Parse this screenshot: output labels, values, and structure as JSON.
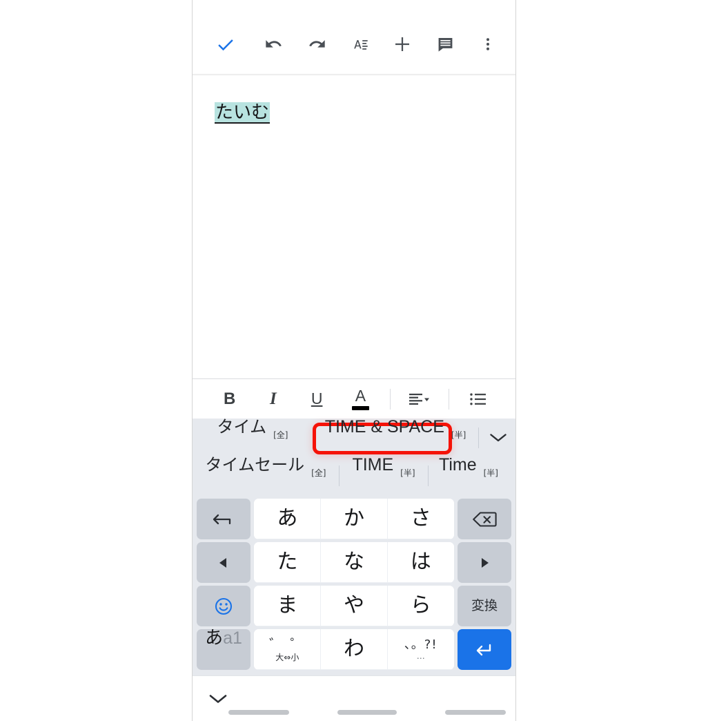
{
  "app": {
    "name": "Google Docs mobile editor with Gboard Japanese 12-key keyboard"
  },
  "top_toolbar": {
    "buttons": [
      {
        "name": "accept-check",
        "icon": "check-icon",
        "label": "完了",
        "color": "#1a73e8"
      },
      {
        "name": "undo",
        "icon": "undo-icon",
        "label": "元に戻す",
        "color": "#4a4f55"
      },
      {
        "name": "redo",
        "icon": "redo-icon",
        "label": "やり直し",
        "color": "#4a4f55"
      },
      {
        "name": "text-format",
        "icon": "text-format-icon",
        "label": "書式設定",
        "color": "#4a4f55"
      },
      {
        "name": "insert",
        "icon": "plus-icon",
        "label": "挿入",
        "color": "#4a4f55"
      },
      {
        "name": "comment",
        "icon": "comment-icon",
        "label": "コメント",
        "color": "#4a4f55"
      },
      {
        "name": "more",
        "icon": "more-vertical-icon",
        "label": "その他",
        "color": "#4a4f55"
      }
    ]
  },
  "document": {
    "composing_text": "たいむ",
    "highlight_color": "#b8e3e0",
    "text_color": "#17181a"
  },
  "format_toolbar": {
    "bold": "B",
    "italic": "I",
    "underline": "U",
    "text_color_glyph": "A",
    "text_color_swatch": "#000000",
    "align": "align-left",
    "list": "bulleted-list"
  },
  "suggestions": {
    "row1": [
      {
        "text": "タイム",
        "tag": "[全]"
      },
      {
        "text": "TIME & SPACE",
        "tag": "[半]",
        "highlighted": true
      }
    ],
    "expand_icon": "chevron-down-icon",
    "row2": [
      {
        "text": "タイムセール",
        "tag": "[全]"
      },
      {
        "text": "TIME",
        "tag": "[半]"
      },
      {
        "text": "Time",
        "tag": "[半]"
      }
    ],
    "annotation_color": "#f51207"
  },
  "keyboard": {
    "rows": [
      {
        "left": {
          "name": "undo-key",
          "icon": "undo-arrow-icon",
          "label": "元に戻す"
        },
        "chars": [
          "あ",
          "か",
          "さ"
        ],
        "right": {
          "name": "backspace-key",
          "icon": "backspace-icon",
          "label": "削除"
        }
      },
      {
        "left": {
          "name": "cursor-left-key",
          "icon": "triangle-left-icon",
          "label": "←"
        },
        "chars": [
          "た",
          "な",
          "は"
        ],
        "right": {
          "name": "cursor-right-key",
          "icon": "triangle-right-icon",
          "label": "→"
        }
      },
      {
        "left": {
          "name": "emoji-key",
          "icon": "smiley-icon",
          "label": "絵文字"
        },
        "chars": [
          "ま",
          "や",
          "ら"
        ],
        "right": {
          "name": "convert-key",
          "icon": "",
          "label": "変換"
        }
      },
      {
        "left": {
          "name": "input-mode-key",
          "icon": "",
          "label_on": "あ",
          "label_off": "a1"
        },
        "chars": [
          "dakuten",
          "わ",
          "punct"
        ],
        "right": {
          "name": "enter-key",
          "icon": "return-icon",
          "label": "改行"
        }
      }
    ],
    "dakuten_key": {
      "top": "゛ ゜",
      "bottom": "大⇔小"
    },
    "punct_key": {
      "main": "、。?!",
      "dots": "…"
    },
    "key_bg": "#ffffff",
    "func_bg": "#c7ccd4",
    "enter_bg": "#1a73e8",
    "keyboard_bg": "#e6e9ee"
  },
  "bottom_bar": {
    "hide_keyboard_icon": "chevron-down-icon",
    "nav_pills": 3
  }
}
